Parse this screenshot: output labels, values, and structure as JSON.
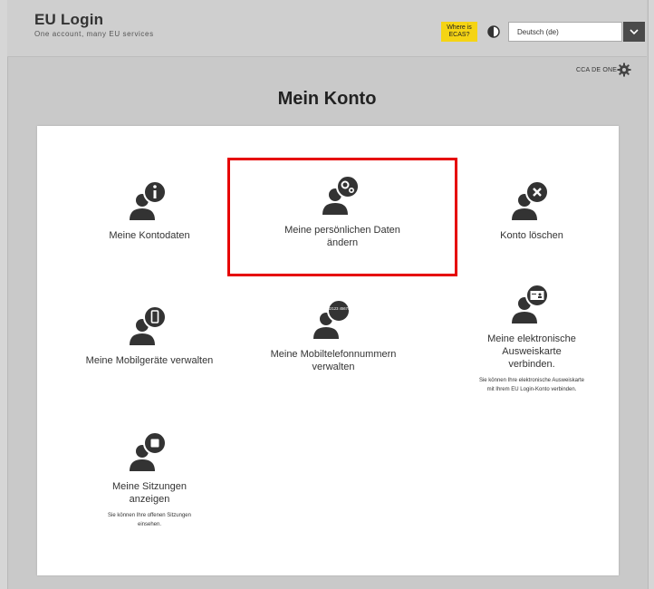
{
  "header": {
    "title": "EU Login",
    "tagline": "One account, many EU services",
    "ecas_label": "Where is ECAS?",
    "language": "Deutsch (de)"
  },
  "account": {
    "name": "CCA DE ONE"
  },
  "page_title": "Mein Konto",
  "tiles": [
    {
      "label": "Meine Kontodaten"
    },
    {
      "label": "Meine persönlichen Daten ändern"
    },
    {
      "label": "Konto löschen"
    },
    {
      "label": "Meine Mobilgeräte verwalten"
    },
    {
      "label": "Meine Mobiltelefonnummern verwalten",
      "badge": "+32123 456789"
    },
    {
      "label": "Meine elektronische Ausweiskarte verbinden.",
      "desc": "Sie können Ihre elektronische Ausweiskarte mit Ihrem EU Login-Konto verbinden."
    },
    {
      "label": "Meine Sitzungen anzeigen",
      "desc": "Sie können Ihre offenen Sitzungen einsehen."
    }
  ],
  "colors": {
    "accent": "#f5d414",
    "highlight": "#e60000",
    "icon": "#333333"
  }
}
